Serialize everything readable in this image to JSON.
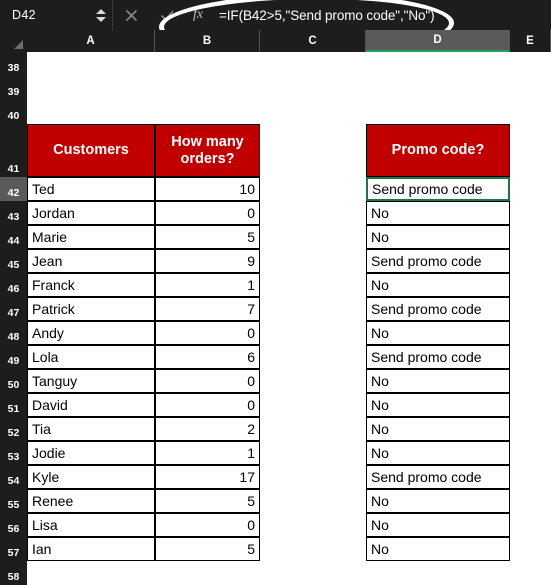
{
  "formula_bar": {
    "name_box_value": "D42",
    "cancel_icon": "close-icon",
    "confirm_icon": "check-icon",
    "fx_label": "fx",
    "formula": "=IF(B42>5,\"Send promo code\",\"No\")"
  },
  "columns": [
    {
      "label": "A",
      "selected": false
    },
    {
      "label": "B",
      "selected": false
    },
    {
      "label": "C",
      "selected": false
    },
    {
      "label": "D",
      "selected": true
    },
    {
      "label": "E",
      "selected": false
    }
  ],
  "table": {
    "headers": {
      "a": "Customers",
      "b": "How many orders?",
      "d": "Promo code?"
    },
    "header_row_number": "41",
    "header_fill_color": "#C00000",
    "selection_color": "#217346"
  },
  "rows": [
    {
      "num": "38",
      "a": "",
      "b": "",
      "d": "",
      "blank": true
    },
    {
      "num": "39",
      "a": "",
      "b": "",
      "d": "",
      "blank": true
    },
    {
      "num": "40",
      "a": "",
      "b": "",
      "d": "",
      "blank": true
    },
    {
      "num": "42",
      "a": "Ted",
      "b": "10",
      "d": "Send promo code"
    },
    {
      "num": "43",
      "a": "Jordan",
      "b": "0",
      "d": "No"
    },
    {
      "num": "44",
      "a": "Marie",
      "b": "5",
      "d": "No"
    },
    {
      "num": "45",
      "a": "Jean",
      "b": "9",
      "d": "Send promo code"
    },
    {
      "num": "46",
      "a": "Franck",
      "b": "1",
      "d": "No"
    },
    {
      "num": "47",
      "a": "Patrick",
      "b": "7",
      "d": "Send promo code"
    },
    {
      "num": "48",
      "a": "Andy",
      "b": "0",
      "d": "No"
    },
    {
      "num": "49",
      "a": "Lola",
      "b": "6",
      "d": "Send promo code"
    },
    {
      "num": "50",
      "a": "Tanguy",
      "b": "0",
      "d": "No"
    },
    {
      "num": "51",
      "a": "David",
      "b": "0",
      "d": "No"
    },
    {
      "num": "52",
      "a": "Tia",
      "b": "2",
      "d": "No"
    },
    {
      "num": "53",
      "a": "Jodie",
      "b": "1",
      "d": "No"
    },
    {
      "num": "54",
      "a": "Kyle",
      "b": "17",
      "d": "Send promo code"
    },
    {
      "num": "55",
      "a": "Renee",
      "b": "5",
      "d": "No"
    },
    {
      "num": "56",
      "a": "Lisa",
      "b": "0",
      "d": "No"
    },
    {
      "num": "57",
      "a": "Ian",
      "b": "5",
      "d": "No"
    },
    {
      "num": "58",
      "a": "",
      "b": "",
      "d": "",
      "blank": true
    }
  ],
  "selected_cell": "D42"
}
